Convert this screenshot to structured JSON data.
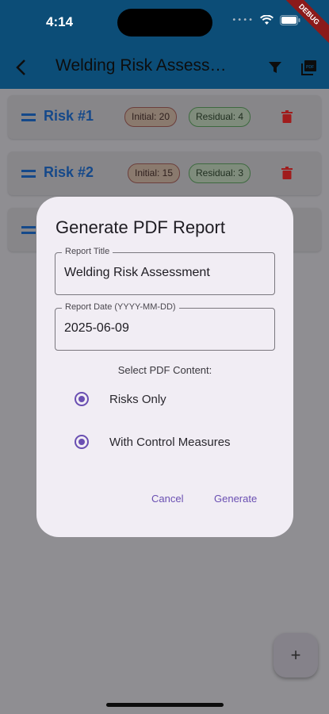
{
  "status": {
    "time": "4:14",
    "debug": "DEBUG"
  },
  "appbar": {
    "title": "Welding Risk Assessment"
  },
  "risks": [
    {
      "title": "Risk #1",
      "initial": "Initial: 20",
      "residual": "Residual: 4"
    },
    {
      "title": "Risk #2",
      "initial": "Initial: 15",
      "residual": "Residual: 3"
    }
  ],
  "dialog": {
    "title": "Generate PDF Report",
    "report_title_label": "Report Title",
    "report_title_value": "Welding Risk Assessment",
    "report_date_label": "Report Date (YYYY-MM-DD)",
    "report_date_value": "2025-06-09",
    "content_label": "Select PDF Content:",
    "option_risks": "Risks Only",
    "option_controls": "With Control Measures",
    "cancel": "Cancel",
    "generate": "Generate"
  },
  "fab": {
    "label": "+"
  },
  "colors": {
    "accent": "#6a4fb2",
    "risk_title": "#15498a",
    "delete": "#d32f2f",
    "appbar": "#0c4d77"
  },
  "icons": [
    "back-arrow-icon",
    "filter-icon",
    "pdf-icon",
    "drag-handle-icon",
    "delete-icon",
    "add-icon",
    "wifi-icon",
    "battery-icon"
  ]
}
